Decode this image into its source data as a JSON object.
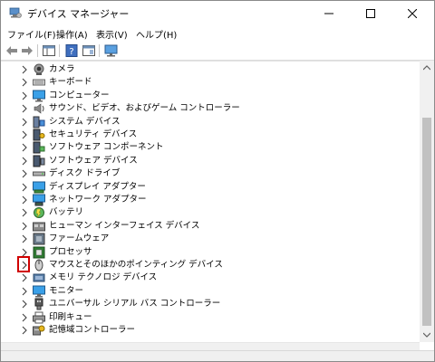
{
  "window": {
    "title": "デバイス マネージャー"
  },
  "menu": [
    "ファイル(F)",
    "操作(A)",
    "表示(V)",
    "ヘルプ(H)"
  ],
  "devices": [
    {
      "label": "カメラ",
      "icon": "camera-icon"
    },
    {
      "label": "キーボード",
      "icon": "keyboard-icon"
    },
    {
      "label": "コンピューター",
      "icon": "computer-icon"
    },
    {
      "label": "サウンド、ビデオ、およびゲーム コントローラー",
      "icon": "speaker-icon"
    },
    {
      "label": "システム デバイス",
      "icon": "system-devices-icon"
    },
    {
      "label": "セキュリティ デバイス",
      "icon": "security-key-icon"
    },
    {
      "label": "ソフトウェア コンポーネント",
      "icon": "software-component-icon"
    },
    {
      "label": "ソフトウェア デバイス",
      "icon": "software-device-icon"
    },
    {
      "label": "ディスク ドライブ",
      "icon": "disk-drive-icon"
    },
    {
      "label": "ディスプレイ アダプター",
      "icon": "display-adapter-icon"
    },
    {
      "label": "ネットワーク アダプター",
      "icon": "network-adapter-icon"
    },
    {
      "label": "バッテリ",
      "icon": "battery-icon"
    },
    {
      "label": "ヒューマン インターフェイス デバイス",
      "icon": "hid-icon"
    },
    {
      "label": "ファームウェア",
      "icon": "firmware-icon"
    },
    {
      "label": "プロセッサ",
      "icon": "processor-icon"
    },
    {
      "label": "マウスとそのほかのポインティング デバイス",
      "icon": "mouse-icon",
      "highlighted": true
    },
    {
      "label": "メモリ テクノロジ デバイス",
      "icon": "memory-icon"
    },
    {
      "label": "モニター",
      "icon": "monitor-icon"
    },
    {
      "label": "ユニバーサル シリアル バス コントローラー",
      "icon": "usb-icon"
    },
    {
      "label": "印刷キュー",
      "icon": "printer-icon"
    },
    {
      "label": "記憶域コントローラー",
      "icon": "storage-controller-icon"
    }
  ],
  "colors": {
    "highlight": "#d00000",
    "icon_blue": "#1e73be",
    "scroll_thumb": "#c1c1c1"
  }
}
